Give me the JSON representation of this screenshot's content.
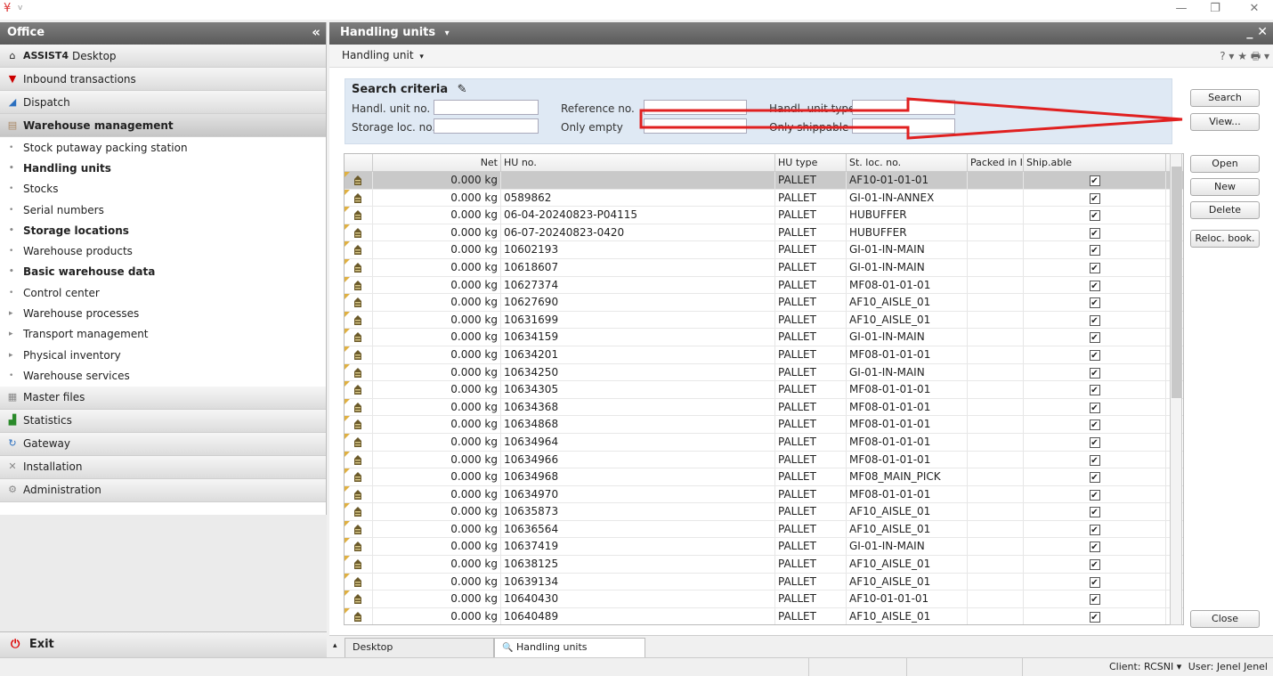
{
  "app": {
    "logo_glyph": "¥",
    "version_glyph": "v"
  },
  "window_controls": {
    "minimize": "—",
    "restore": "❐",
    "close": "✕"
  },
  "left_panel": {
    "title": "Office",
    "collapse_glyph": "«",
    "desktop_brand": "ASSIST4",
    "desktop_label": "Desktop",
    "sections": [
      {
        "label": "Inbound transactions",
        "icon": "funnel-icon"
      },
      {
        "label": "Dispatch",
        "icon": "truck-icon"
      },
      {
        "label": "Warehouse management",
        "icon": "shelf-icon"
      }
    ],
    "sub_items": [
      {
        "label": "Stock putaway packing station",
        "bold": false,
        "bullet": "•"
      },
      {
        "label": "Handling units",
        "bold": true,
        "bullet": "•"
      },
      {
        "label": "Stocks",
        "bold": false,
        "bullet": "•"
      },
      {
        "label": "Serial numbers",
        "bold": false,
        "bullet": "•"
      },
      {
        "label": "Storage locations",
        "bold": true,
        "bullet": "•"
      },
      {
        "label": "Warehouse products",
        "bold": false,
        "bullet": "•"
      },
      {
        "label": "Basic warehouse data",
        "bold": true,
        "bullet": "•"
      },
      {
        "label": "Control center",
        "bold": false,
        "bullet": "•"
      },
      {
        "label": "Warehouse processes",
        "bold": false,
        "bullet": "▸"
      },
      {
        "label": "Transport management",
        "bold": false,
        "bullet": "▸"
      },
      {
        "label": "Physical inventory",
        "bold": false,
        "bullet": "▸"
      },
      {
        "label": "Warehouse services",
        "bold": false,
        "bullet": "•"
      }
    ],
    "lower_sections": [
      {
        "label": "Master files",
        "icon": "master-files-icon"
      },
      {
        "label": "Statistics",
        "icon": "bar-chart-icon"
      },
      {
        "label": "Gateway",
        "icon": "refresh-icon"
      },
      {
        "label": "Installation",
        "icon": "tools-icon"
      },
      {
        "label": "Administration",
        "icon": "gears-icon"
      }
    ],
    "exit_label": "Exit"
  },
  "main": {
    "title": "Handling units",
    "title_dropdown": "▾",
    "close_glyph": "_ ✕",
    "subtitle": "Handling unit",
    "subtitle_dropdown": "▾",
    "tools": "? ▾ ★ 🖶 ▾",
    "search": {
      "title": "Search criteria",
      "edit_glyph": "✎",
      "labels": {
        "handl_unit_no": "Handl. unit no.",
        "reference_no": "Reference no.",
        "handl_unit_type": "Handl. unit type",
        "storage_loc_no": "Storage loc. no.",
        "only_empty": "Only empty",
        "only_shippable": "Only shippable"
      }
    },
    "buttons": {
      "search": "Search",
      "view": "View...",
      "open": "Open",
      "new": "New",
      "delete": "Delete",
      "reloc": "Reloc. book.",
      "close": "Close"
    },
    "columns": [
      "",
      "Net",
      "HU no.",
      "HU type",
      "St. loc. no.",
      "Packed in I",
      "Ship.able"
    ],
    "rows": [
      {
        "net": "0.000 kg",
        "hu_no": "",
        "type": "PALLET",
        "loc": "AF10-01-01-01",
        "check": "✔"
      },
      {
        "net": "0.000 kg",
        "hu_no": "0589862",
        "type": "PALLET",
        "loc": "GI-01-IN-ANNEX",
        "check": "✔"
      },
      {
        "net": "0.000 kg",
        "hu_no": "06-04-20240823-P04115",
        "type": "PALLET",
        "loc": "HUBUFFER",
        "check": "✔"
      },
      {
        "net": "0.000 kg",
        "hu_no": "06-07-20240823-0420",
        "type": "PALLET",
        "loc": "HUBUFFER",
        "check": "✔"
      },
      {
        "net": "0.000 kg",
        "hu_no": "10602193",
        "type": "PALLET",
        "loc": "GI-01-IN-MAIN",
        "check": "✔"
      },
      {
        "net": "0.000 kg",
        "hu_no": "10618607",
        "type": "PALLET",
        "loc": "GI-01-IN-MAIN",
        "check": "✔"
      },
      {
        "net": "0.000 kg",
        "hu_no": "10627374",
        "type": "PALLET",
        "loc": "MF08-01-01-01",
        "check": "✔"
      },
      {
        "net": "0.000 kg",
        "hu_no": "10627690",
        "type": "PALLET",
        "loc": "AF10_AISLE_01",
        "check": "✔"
      },
      {
        "net": "0.000 kg",
        "hu_no": "10631699",
        "type": "PALLET",
        "loc": "AF10_AISLE_01",
        "check": "✔"
      },
      {
        "net": "0.000 kg",
        "hu_no": "10634159",
        "type": "PALLET",
        "loc": "GI-01-IN-MAIN",
        "check": "✔"
      },
      {
        "net": "0.000 kg",
        "hu_no": "10634201",
        "type": "PALLET",
        "loc": "MF08-01-01-01",
        "check": "✔"
      },
      {
        "net": "0.000 kg",
        "hu_no": "10634250",
        "type": "PALLET",
        "loc": "GI-01-IN-MAIN",
        "check": "✔"
      },
      {
        "net": "0.000 kg",
        "hu_no": "10634305",
        "type": "PALLET",
        "loc": "MF08-01-01-01",
        "check": "✔"
      },
      {
        "net": "0.000 kg",
        "hu_no": "10634368",
        "type": "PALLET",
        "loc": "MF08-01-01-01",
        "check": "✔"
      },
      {
        "net": "0.000 kg",
        "hu_no": "10634868",
        "type": "PALLET",
        "loc": "MF08-01-01-01",
        "check": "✔"
      },
      {
        "net": "0.000 kg",
        "hu_no": "10634964",
        "type": "PALLET",
        "loc": "MF08-01-01-01",
        "check": "✔"
      },
      {
        "net": "0.000 kg",
        "hu_no": "10634966",
        "type": "PALLET",
        "loc": "MF08-01-01-01",
        "check": "✔"
      },
      {
        "net": "0.000 kg",
        "hu_no": "10634968",
        "type": "PALLET",
        "loc": "MF08_MAIN_PICK",
        "check": "✔"
      },
      {
        "net": "0.000 kg",
        "hu_no": "10634970",
        "type": "PALLET",
        "loc": "MF08-01-01-01",
        "check": "✔"
      },
      {
        "net": "0.000 kg",
        "hu_no": "10635873",
        "type": "PALLET",
        "loc": "AF10_AISLE_01",
        "check": "✔"
      },
      {
        "net": "0.000 kg",
        "hu_no": "10636564",
        "type": "PALLET",
        "loc": "AF10_AISLE_01",
        "check": "✔"
      },
      {
        "net": "0.000 kg",
        "hu_no": "10637419",
        "type": "PALLET",
        "loc": "GI-01-IN-MAIN",
        "check": "✔"
      },
      {
        "net": "0.000 kg",
        "hu_no": "10638125",
        "type": "PALLET",
        "loc": "AF10_AISLE_01",
        "check": "✔"
      },
      {
        "net": "0.000 kg",
        "hu_no": "10639134",
        "type": "PALLET",
        "loc": "AF10_AISLE_01",
        "check": "✔"
      },
      {
        "net": "0.000 kg",
        "hu_no": "10640430",
        "type": "PALLET",
        "loc": "AF10-01-01-01",
        "check": "✔"
      },
      {
        "net": "0.000 kg",
        "hu_no": "10640489",
        "type": "PALLET",
        "loc": "AF10_AISLE_01",
        "check": "✔"
      }
    ]
  },
  "bottom_tabs": {
    "arrow": "▴",
    "tabs": [
      "Desktop",
      "Handling units"
    ],
    "search_glyph": "🔍"
  },
  "status": {
    "client_label": "Client:",
    "client": "RCSNI",
    "user_label": "User:",
    "user": "Jenel Jenel",
    "dropdown": "▾"
  },
  "colors": {
    "header": "#6a6a6a",
    "criteria_bg": "#dfe9f4",
    "annotation_arrow": "#e02020",
    "selected_row": "#c9c9c9"
  }
}
